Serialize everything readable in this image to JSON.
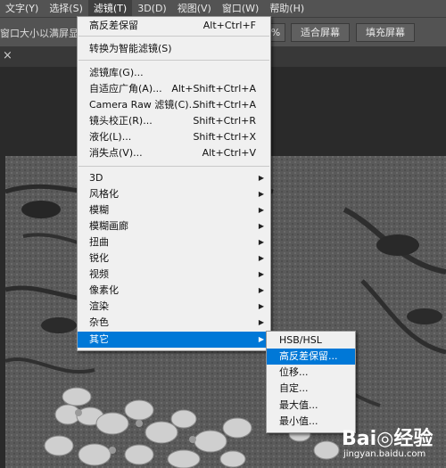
{
  "menubar": {
    "items": [
      "文字(Y)",
      "选择(S)",
      "滤镜(T)",
      "3D(D)",
      "视图(V)",
      "窗口(W)",
      "帮助(H)"
    ],
    "active_index": 2
  },
  "options_bar": {
    "text": "窗口大小以满屏显示",
    "partial_button": "%",
    "buttons": [
      "适合屏幕",
      "填充屏幕"
    ]
  },
  "tab_close": "×",
  "filter_menu": {
    "items": [
      {
        "label": "高反差保留",
        "shortcut": "Alt+Ctrl+F",
        "submenu": false,
        "highlighted": false
      },
      {
        "separator": true
      },
      {
        "label": "转换为智能滤镜(S)",
        "shortcut": "",
        "submenu": false,
        "highlighted": false
      },
      {
        "separator": true
      },
      {
        "label": "滤镜库(G)...",
        "shortcut": "",
        "submenu": false,
        "highlighted": false
      },
      {
        "label": "自适应广角(A)...",
        "shortcut": "Alt+Shift+Ctrl+A",
        "submenu": false,
        "highlighted": false
      },
      {
        "label": "Camera Raw 滤镜(C)...",
        "shortcut": "Shift+Ctrl+A",
        "submenu": false,
        "highlighted": false
      },
      {
        "label": "镜头校正(R)...",
        "shortcut": "Shift+Ctrl+R",
        "submenu": false,
        "highlighted": false
      },
      {
        "label": "液化(L)...",
        "shortcut": "Shift+Ctrl+X",
        "submenu": false,
        "highlighted": false
      },
      {
        "label": "消失点(V)...",
        "shortcut": "Alt+Ctrl+V",
        "submenu": false,
        "highlighted": false
      },
      {
        "separator": true
      },
      {
        "label": "3D",
        "shortcut": "",
        "submenu": true,
        "highlighted": false
      },
      {
        "label": "风格化",
        "shortcut": "",
        "submenu": true,
        "highlighted": false
      },
      {
        "label": "模糊",
        "shortcut": "",
        "submenu": true,
        "highlighted": false
      },
      {
        "label": "模糊画廊",
        "shortcut": "",
        "submenu": true,
        "highlighted": false
      },
      {
        "label": "扭曲",
        "shortcut": "",
        "submenu": true,
        "highlighted": false
      },
      {
        "label": "锐化",
        "shortcut": "",
        "submenu": true,
        "highlighted": false
      },
      {
        "label": "视频",
        "shortcut": "",
        "submenu": true,
        "highlighted": false
      },
      {
        "label": "像素化",
        "shortcut": "",
        "submenu": true,
        "highlighted": false
      },
      {
        "label": "渲染",
        "shortcut": "",
        "submenu": true,
        "highlighted": false
      },
      {
        "label": "杂色",
        "shortcut": "",
        "submenu": true,
        "highlighted": false
      },
      {
        "label": "其它",
        "shortcut": "",
        "submenu": true,
        "highlighted": true
      }
    ]
  },
  "other_submenu": {
    "items": [
      {
        "label": "HSB/HSL",
        "highlighted": false
      },
      {
        "label": "高反差保留...",
        "highlighted": true
      },
      {
        "label": "位移...",
        "highlighted": false
      },
      {
        "label": "自定...",
        "highlighted": false
      },
      {
        "label": "最大值...",
        "highlighted": false
      },
      {
        "label": "最小值...",
        "highlighted": false
      }
    ]
  },
  "watermark": {
    "logo": "Bai◎经验",
    "url": "jingyan.baidu.com"
  },
  "colors": {
    "highlight": "#0078d7",
    "menu_bg": "#f0f0f0",
    "chrome": "#535353"
  }
}
